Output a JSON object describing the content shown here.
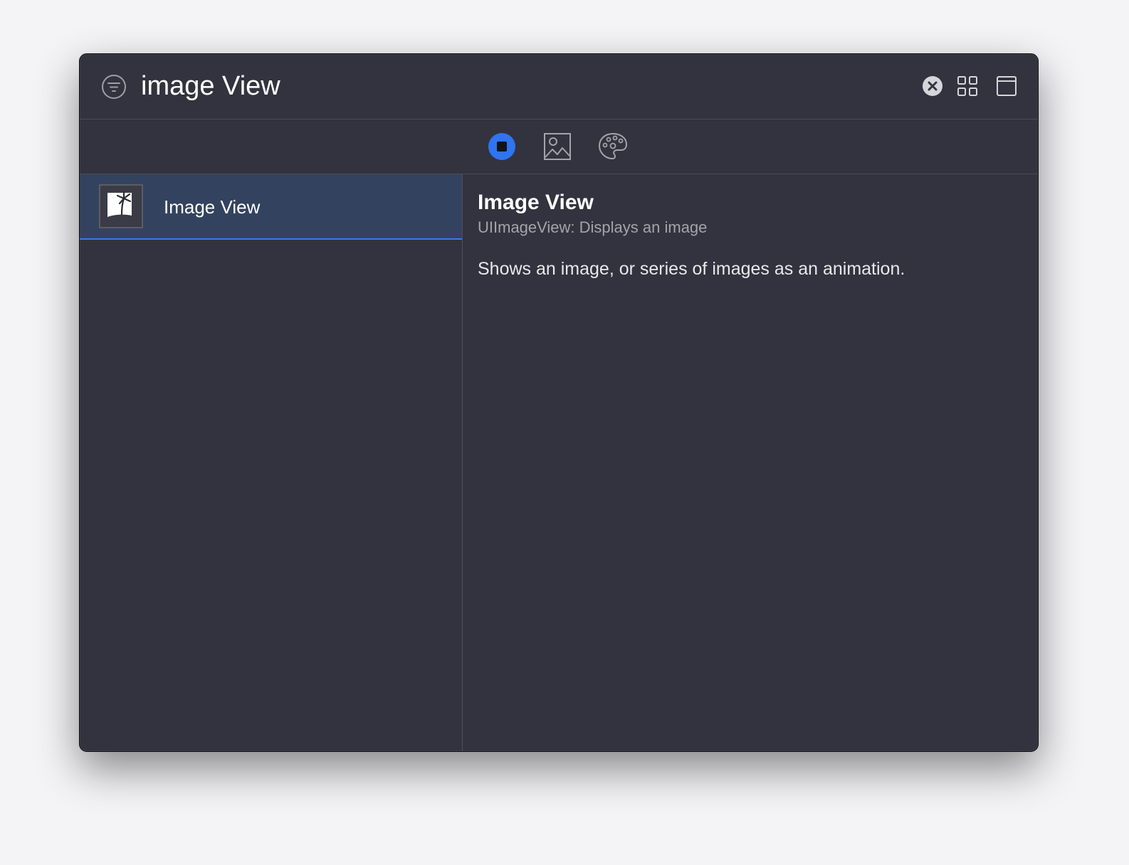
{
  "search": {
    "query": "image View",
    "filter_icon": "filter-circle-icon",
    "clear_icon": "clear-circle-x-icon",
    "grid_icon": "grid-view-icon",
    "window_icon": "window-icon"
  },
  "library_tabs": [
    {
      "name": "objects",
      "icon": "objects-square-icon",
      "selected": true
    },
    {
      "name": "media",
      "icon": "photo-icon",
      "selected": false
    },
    {
      "name": "colors",
      "icon": "palette-icon",
      "selected": false
    }
  ],
  "results": [
    {
      "label": "Image View",
      "icon": "image-view-thumb-icon",
      "selected": true
    }
  ],
  "detail": {
    "title": "Image View",
    "subtitle": "UIImageView: Displays an image",
    "description": "Shows an image, or series of images as an animation."
  },
  "colors": {
    "accent": "#2f74f0",
    "selection": "#33435f",
    "background": "#32333e"
  }
}
